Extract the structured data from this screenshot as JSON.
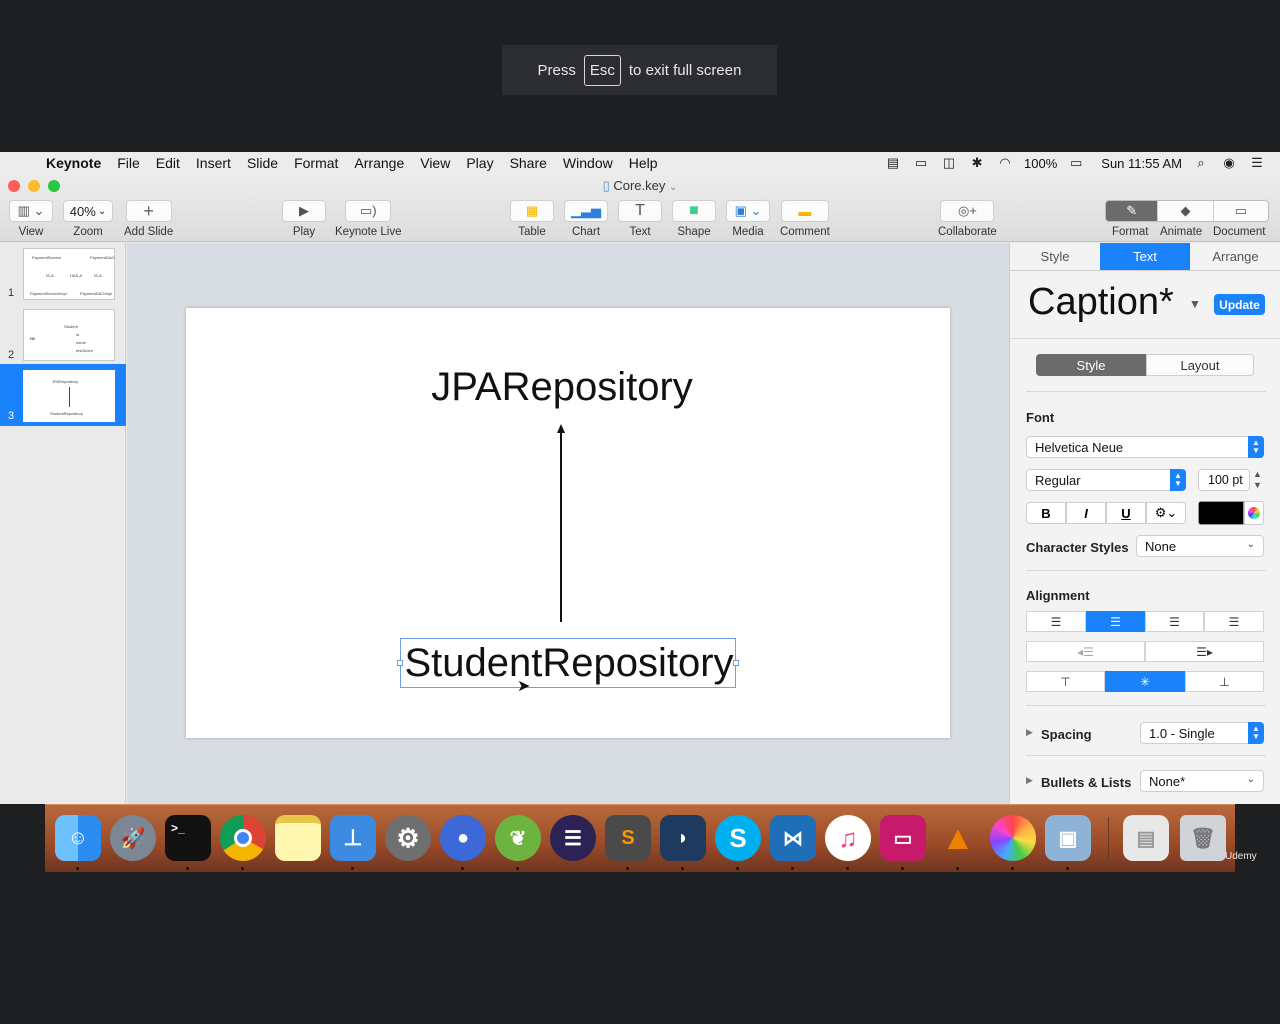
{
  "fullscreen_hint": {
    "press": "Press",
    "key": "Esc",
    "rest": "to exit full screen"
  },
  "menubar": {
    "app": "Keynote",
    "items": [
      "File",
      "Edit",
      "Insert",
      "Slide",
      "Format",
      "Arrange",
      "View",
      "Play",
      "Share",
      "Window",
      "Help"
    ],
    "battery": "100%",
    "clock": "Sun 11:55 AM"
  },
  "window": {
    "title": "Core.key"
  },
  "toolbar": {
    "view": "View",
    "zoom_value": "40%",
    "zoom": "Zoom",
    "add_slide": "Add Slide",
    "play": "Play",
    "keynote_live": "Keynote Live",
    "table": "Table",
    "chart": "Chart",
    "text": "Text",
    "shape": "Shape",
    "media": "Media",
    "comment": "Comment",
    "collaborate": "Collaborate",
    "format": "Format",
    "animate": "Animate",
    "document": "Document"
  },
  "navigator": {
    "slides": [
      {
        "num": "1",
        "texts": [
          "PaymentService",
          "PaymentDAO",
          "IS-A",
          "HAS-A",
          "IS-A",
          "PaymentServiceImpl",
          "PaymentDAOImpl"
        ]
      },
      {
        "num": "2",
        "texts": [
          "Student",
          "id",
          "name",
          "testScore",
          "H2"
        ]
      },
      {
        "num": "3",
        "texts": [
          "JPARepository",
          "StudentRepository"
        ]
      }
    ]
  },
  "slide": {
    "title": "JPARepository",
    "caption": "StudentRepository"
  },
  "inspector": {
    "tabs": [
      "Style",
      "Text",
      "Arrange"
    ],
    "paragraph_style": "Caption*",
    "update": "Update",
    "subtabs": [
      "Style",
      "Layout"
    ],
    "font_label": "Font",
    "font_family": "Helvetica Neue",
    "font_weight": "Regular",
    "font_size": "100 pt",
    "bold": "B",
    "italic": "I",
    "underline": "U",
    "text_color": "#000000",
    "char_styles_label": "Character Styles",
    "char_styles_value": "None",
    "alignment_label": "Alignment",
    "spacing_label": "Spacing",
    "spacing_value": "1.0 - Single",
    "bullets_label": "Bullets & Lists",
    "bullets_value": "None*"
  },
  "colors": {
    "accent": "#1a82fb",
    "dock": "#9a4a28"
  },
  "dock": {
    "apps": [
      "finder-icon",
      "launchpad-icon",
      "terminal-icon",
      "chrome-icon",
      "notes-icon",
      "keynote-icon",
      "system-preferences-icon",
      "screen-recorder-icon",
      "spring-tool-icon",
      "eclipse-icon",
      "sublime-text-icon",
      "mysql-workbench-icon",
      "skype-icon",
      "vscode-icon",
      "itunes-icon",
      "cleanmymac-icon",
      "vlc-icon",
      "photos-icon",
      "preview-icon",
      "documents-icon",
      "trash-icon"
    ],
    "watermark": "Udemy"
  }
}
